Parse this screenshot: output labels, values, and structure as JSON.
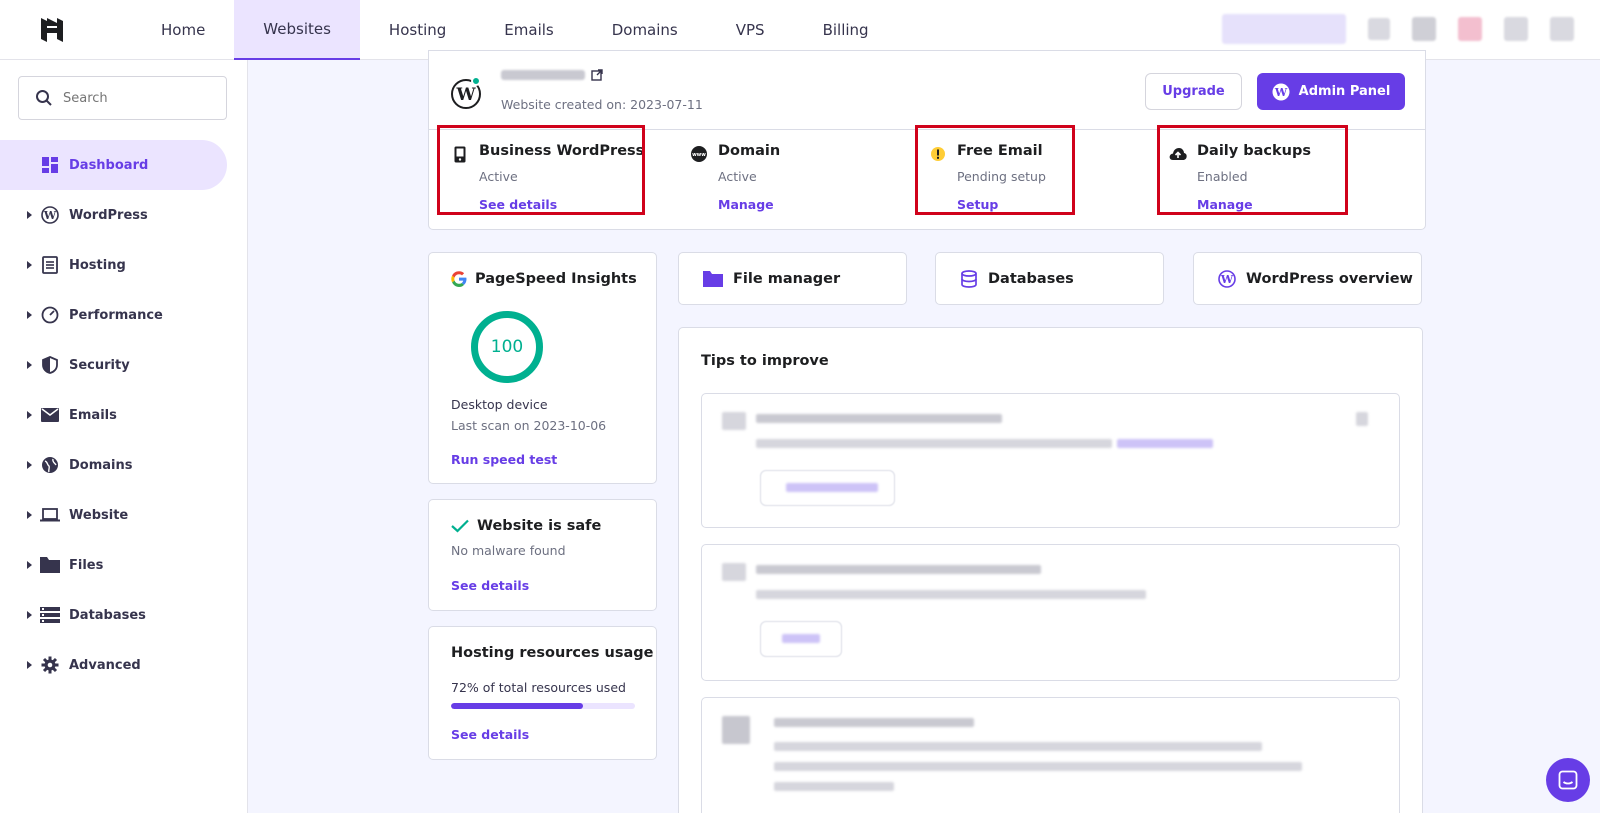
{
  "nav": {
    "items": [
      {
        "label": "Home"
      },
      {
        "label": "Websites"
      },
      {
        "label": "Hosting"
      },
      {
        "label": "Emails"
      },
      {
        "label": "Domains"
      },
      {
        "label": "VPS"
      },
      {
        "label": "Billing"
      }
    ],
    "active": "Websites"
  },
  "sidebar": {
    "search_placeholder": "Search",
    "items": [
      {
        "label": "Dashboard",
        "icon": "dashboard-icon"
      },
      {
        "label": "WordPress",
        "icon": "wordpress-icon"
      },
      {
        "label": "Hosting",
        "icon": "server-icon"
      },
      {
        "label": "Performance",
        "icon": "speedometer-icon"
      },
      {
        "label": "Security",
        "icon": "shield-icon"
      },
      {
        "label": "Emails",
        "icon": "mail-icon"
      },
      {
        "label": "Domains",
        "icon": "globe-icon"
      },
      {
        "label": "Website",
        "icon": "laptop-icon"
      },
      {
        "label": "Files",
        "icon": "folder-icon"
      },
      {
        "label": "Databases",
        "icon": "database-icon"
      },
      {
        "label": "Advanced",
        "icon": "gear-icon"
      }
    ]
  },
  "site": {
    "created": "Website created on: 2023-07-11",
    "upgrade_label": "Upgrade",
    "admin_label": "Admin Panel"
  },
  "plans": [
    {
      "title": "Business WordPress",
      "status": "Active",
      "link": "See details",
      "icon": "phone-icon"
    },
    {
      "title": "Domain",
      "status": "Active",
      "link": "Manage",
      "icon": "www-icon"
    },
    {
      "title": "Free Email",
      "status": "Pending setup",
      "link": "Setup",
      "icon": "warning-icon"
    },
    {
      "title": "Daily backups",
      "status": "Enabled",
      "link": "Manage",
      "icon": "cloud-upload-icon"
    }
  ],
  "quick_links": [
    {
      "label": "File manager",
      "icon": "folder-icon"
    },
    {
      "label": "Databases",
      "icon": "database-icon"
    },
    {
      "label": "WordPress overview",
      "icon": "wordpress-icon"
    }
  ],
  "pagespeed": {
    "title": "PageSpeed Insights",
    "score": "100",
    "device": "Desktop device",
    "last_scan": "Last scan on 2023-10-06",
    "link": "Run speed test"
  },
  "security": {
    "title": "Website is safe",
    "subtitle": "No malware found",
    "link": "See details"
  },
  "resources": {
    "title": "Hosting resources usage",
    "usage_text": "72% of total resources used",
    "usage_fraction": 0.72,
    "link": "See details"
  },
  "tips": {
    "title": "Tips to improve"
  },
  "colors": {
    "accent": "#673de6",
    "success": "#00b090",
    "highlight": "#d0021b"
  }
}
